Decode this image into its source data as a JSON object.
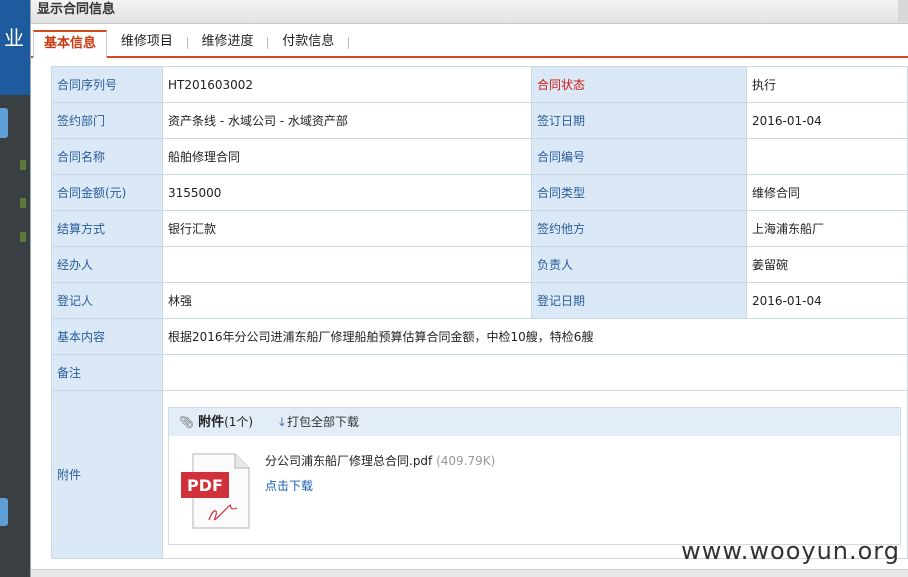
{
  "dialog": {
    "title": "显示合同信息"
  },
  "tabs": [
    {
      "label": "基本信息",
      "active": true
    },
    {
      "label": "维修项目"
    },
    {
      "label": "维修进度"
    },
    {
      "label": "付款信息"
    }
  ],
  "fields": {
    "serial_label": "合同序列号",
    "serial_value": "HT201603002",
    "status_label": "合同状态",
    "status_value": "执行",
    "dept_label": "签约部门",
    "dept_value": "资产条线 - 水域公司 - 水域资产部",
    "sign_date_label": "签订日期",
    "sign_date_value": "2016-01-04",
    "name_label": "合同名称",
    "name_value": "船舶修理合同",
    "number_label": "合同编号",
    "number_value": "",
    "amount_label": "合同金额(元)",
    "amount_value": "3155000",
    "type_label": "合同类型",
    "type_value": "维修合同",
    "settle_label": "结算方式",
    "settle_value": "银行汇款",
    "party_label": "签约他方",
    "party_value": "上海浦东船厂",
    "handler_label": "经办人",
    "handler_value": "",
    "owner_label": "负责人",
    "owner_value": "姜留碗",
    "registrar_label": "登记人",
    "registrar_value": "林强",
    "reg_date_label": "登记日期",
    "reg_date_value": "2016-01-04",
    "content_label": "基本内容",
    "content_value": "根据2016年分公司进浦东船厂修理船舶预算估算合同金额，中检10艘，特检6艘",
    "remark_label": "备注",
    "remark_value": "",
    "attach_label": "附件"
  },
  "attachment": {
    "title": "附件",
    "count": "(1个)",
    "download_all": "打包全部下载",
    "file_name": "分公司浦东船厂修理总合同.pdf",
    "file_size": "(409.79K)",
    "file_link": "点击下载",
    "icon_text": "PDF"
  },
  "left_app": {
    "fragment": "业"
  },
  "watermark": "www.wooyun.org",
  "colors": {
    "accent": "#d04a1e",
    "label_bg": "#dbe8f5",
    "label_text": "#2a5d9a",
    "status_red": "#d01818",
    "pdf_red": "#d0303a"
  }
}
